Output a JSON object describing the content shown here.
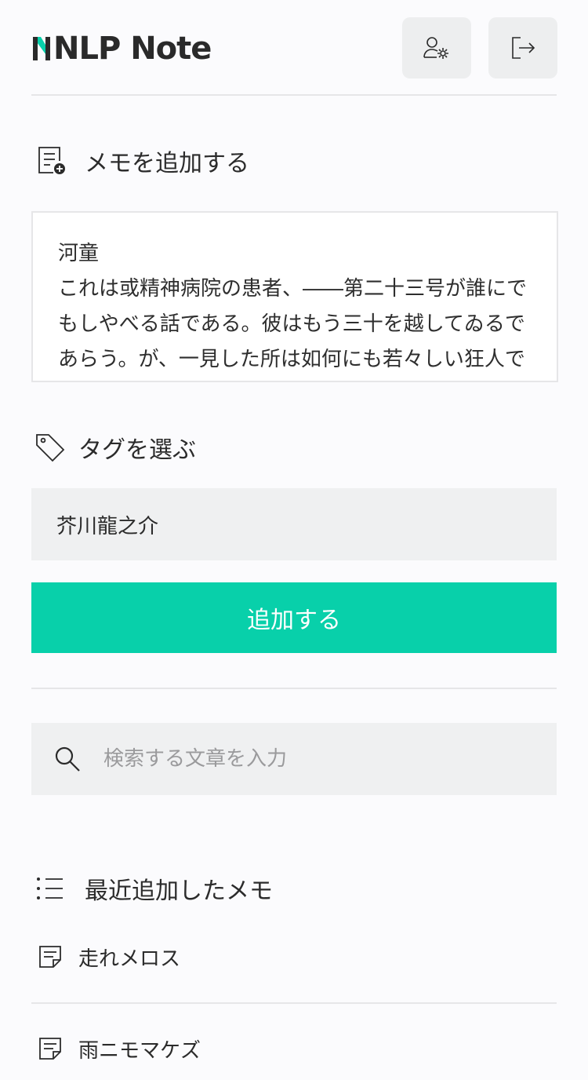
{
  "header": {
    "logo_text": "NLP Note",
    "profile_icon": "user-settings-icon",
    "logout_icon": "logout-icon"
  },
  "add_memo": {
    "title": "メモを追加する",
    "icon": "note-add-icon",
    "text": "河童\nこれは或精神病院の患者、――第二十三号が誰にでもしやべる話である。彼はもう三十を越してゐるであらう。が、一見した所は如何にも若々しい狂人であ"
  },
  "tags": {
    "title": "タグを選ぶ",
    "icon": "tag-icon",
    "selected": "芥川龍之介"
  },
  "add_button": {
    "label": "追加する"
  },
  "search": {
    "icon": "search-icon",
    "placeholder": "検索する文章を入力",
    "value": ""
  },
  "recent": {
    "title": "最近追加したメモ",
    "icon": "list-icon",
    "items": [
      {
        "title": "走れメロス",
        "icon": "memo-icon"
      },
      {
        "title": "雨ニモマケズ",
        "icon": "memo-icon"
      }
    ]
  },
  "colors": {
    "accent": "#08d0aa",
    "field_bg": "#eff0f1",
    "text": "#2b2b2b"
  }
}
